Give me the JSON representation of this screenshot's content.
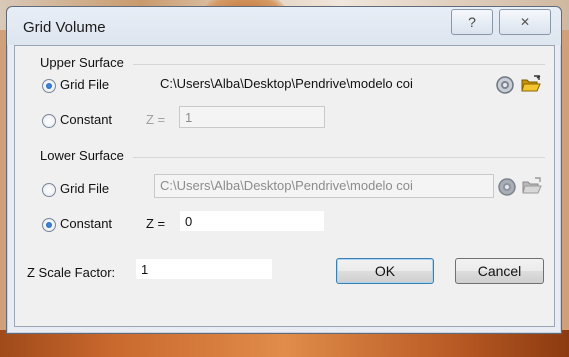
{
  "dialog": {
    "title": "Grid Volume",
    "help_label": "?",
    "close_label": "✕"
  },
  "upper_surface": {
    "group_label": "Upper Surface",
    "grid_file_label": "Grid File",
    "grid_file_path": "C:\\Users\\Alba\\Desktop\\Pendrive\\modelo coi",
    "constant_label": "Constant",
    "z_label": "Z =",
    "z_value": "1",
    "selected": "grid_file"
  },
  "lower_surface": {
    "group_label": "Lower Surface",
    "grid_file_label": "Grid File",
    "grid_file_path": "C:\\Users\\Alba\\Desktop\\Pendrive\\modelo coi",
    "constant_label": "Constant",
    "z_label": "Z =",
    "z_value": "0",
    "selected": "constant"
  },
  "z_scale": {
    "label": "Z Scale Factor:",
    "value": "1"
  },
  "buttons": {
    "ok": "OK",
    "cancel": "Cancel"
  },
  "icons": {
    "info": "info-icon",
    "open_folder": "open-folder-icon"
  },
  "colors": {
    "accent": "#1c5fb8",
    "folder": "#e8b417"
  }
}
